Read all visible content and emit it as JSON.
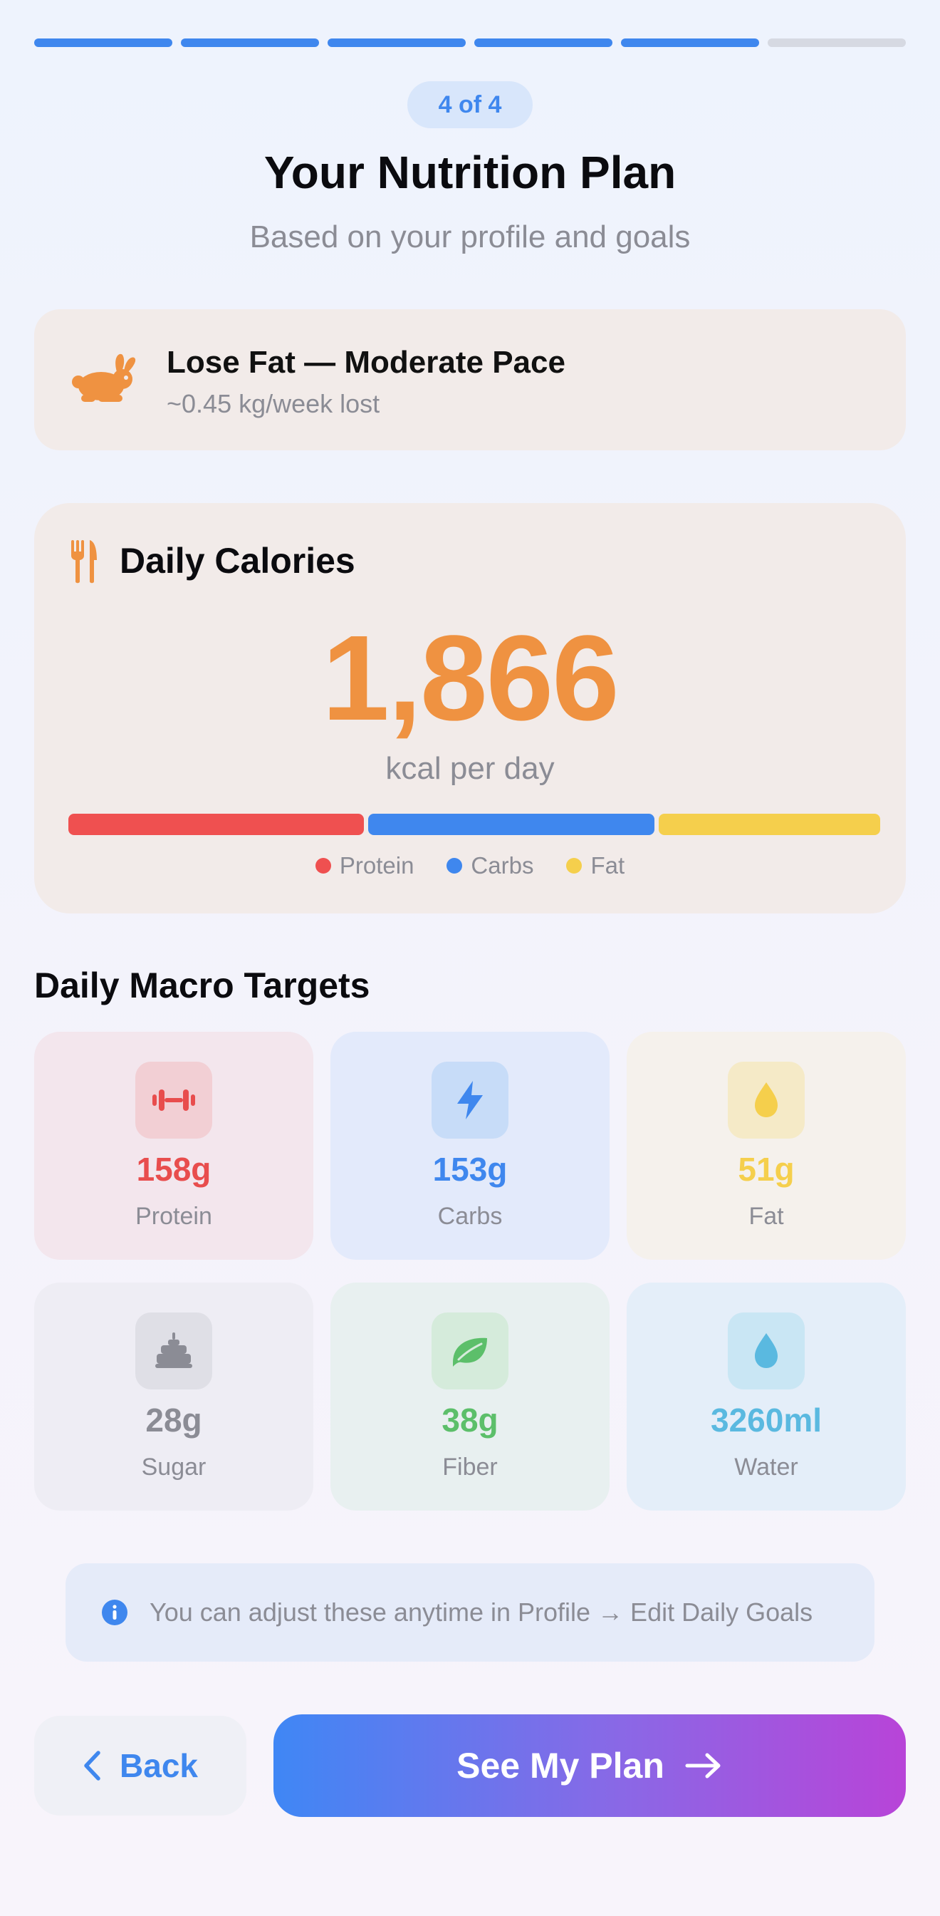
{
  "progress": {
    "total_steps": 6,
    "completed_steps": 5
  },
  "step_pill": "4 of 4",
  "header": {
    "title": "Your Nutrition Plan",
    "subtitle": "Based on your profile and goals"
  },
  "goal": {
    "icon": "rabbit-icon",
    "title": "Lose Fat — Moderate Pace",
    "detail": "~0.45 kg/week lost"
  },
  "calories": {
    "icon": "fork-knife-icon",
    "label": "Daily Calories",
    "value": "1,866",
    "unit": "kcal per day",
    "split": [
      {
        "name": "Protein",
        "fraction": 0.368,
        "color": "#ef5050"
      },
      {
        "name": "Carbs",
        "fraction": 0.356,
        "color": "#3f87ee"
      },
      {
        "name": "Fat",
        "fraction": 0.276,
        "color": "#f5cf4c"
      }
    ]
  },
  "targets": {
    "title": "Daily Macro Targets",
    "items": [
      {
        "value": "158g",
        "label": "Protein",
        "icon": "dumbbell-icon",
        "color": "#e84d4d",
        "tile_bg": "#f3e6ed",
        "icon_bg": "#f2cfd4"
      },
      {
        "value": "153g",
        "label": "Carbs",
        "icon": "bolt-icon",
        "color": "#3f87ee",
        "tile_bg": "#e3eafb",
        "icon_bg": "#c7dcf8"
      },
      {
        "value": "51g",
        "label": "Fat",
        "icon": "drop-icon",
        "color": "#f5cf4c",
        "tile_bg": "#f5f1ec",
        "icon_bg": "#f5eac7"
      },
      {
        "value": "28g",
        "label": "Sugar",
        "icon": "cake-icon",
        "color": "#8b8c95",
        "tile_bg": "#eeedf4",
        "icon_bg": "#dfdfe6"
      },
      {
        "value": "38g",
        "label": "Fiber",
        "icon": "leaf-icon",
        "color": "#5cbf6a",
        "tile_bg": "#e8f0f0",
        "icon_bg": "#d5ebdb"
      },
      {
        "value": "3260ml",
        "label": "Water",
        "icon": "water-drop-icon",
        "color": "#5ab9e0",
        "tile_bg": "#e4eef9",
        "icon_bg": "#c9e6f4"
      }
    ]
  },
  "info": {
    "icon": "info-icon",
    "text": "You can adjust these anytime in Profile → Edit Daily Goals"
  },
  "buttons": {
    "back_label": "Back",
    "primary_label": "See My Plan"
  }
}
